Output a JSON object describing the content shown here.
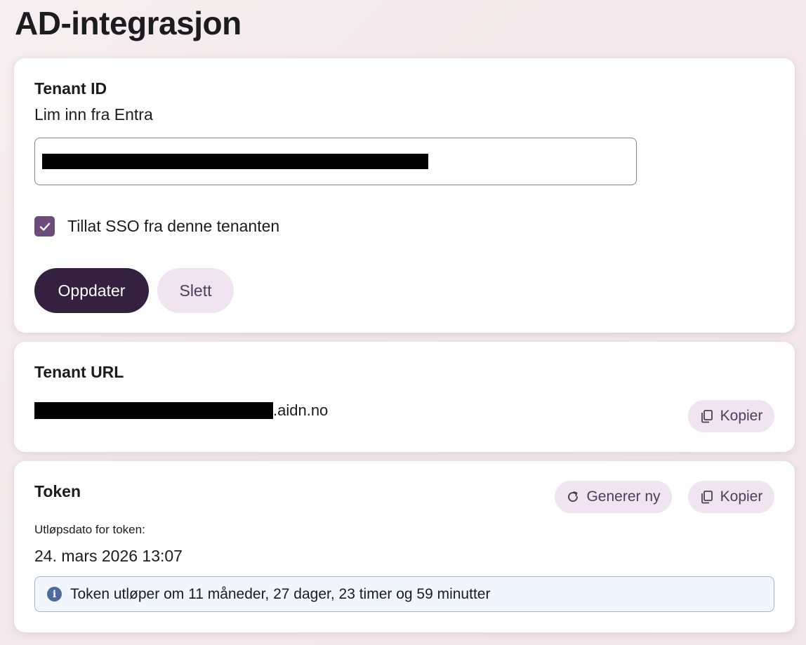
{
  "page": {
    "title": "AD-integrasjon"
  },
  "tenant": {
    "label": "Tenant ID",
    "description": "Lim inn fra Entra",
    "input_value": "",
    "sso_checkbox_checked": true,
    "sso_checkbox_label": "Tillat SSO fra denne tenanten",
    "update_button": "Oppdater",
    "delete_button": "Slett"
  },
  "tenant_url": {
    "label": "Tenant URL",
    "url_suffix": ".aidn.no",
    "copy_button": "Kopier",
    "copy_icon": "copy-icon"
  },
  "token": {
    "label": "Token",
    "regenerate_button": "Generer ny",
    "regenerate_icon": "refresh-icon",
    "copy_button": "Kopier",
    "copy_icon": "copy-icon",
    "expiry_caption": "Utløpsdato for token:",
    "expiry_date": "24. mars 2026 13:07",
    "info_icon": "info-icon",
    "info_text": "Token utløper om 11 måneder, 27 dager, 23 timer og 59 minutter"
  },
  "colors": {
    "primary_button": "#33213f",
    "tonal_button": "#efe4f0",
    "checkbox": "#6b4c7c",
    "info_background": "#f1f5fd",
    "info_border": "#9fb4d8",
    "redaction": "#000000"
  }
}
